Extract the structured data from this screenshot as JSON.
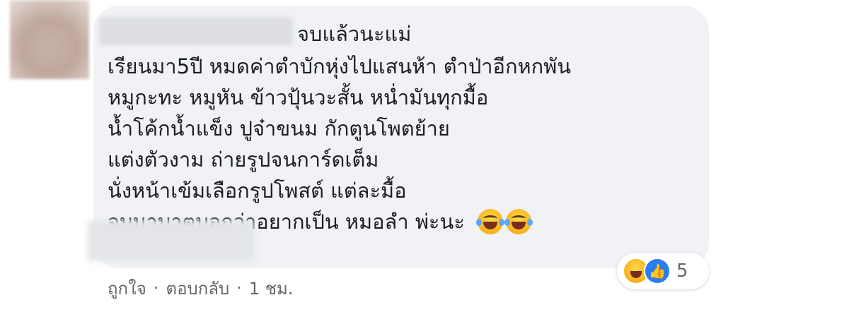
{
  "comment": {
    "first_line": "จบแล้วนะแม่",
    "lines": [
      "เรียนมา5ปี หมดค่าตำบักหุ่งไปแสนห้า ตำป่าอีกหกพัน",
      "หมูกะทะ หมูหัน ข้าวปุ้นวะสั้น หน่ำมันทุกมื้อ",
      "น้ำโค้กน้ำแข็ง ปูจ๋าขนม กักตูนโพตย้าย",
      "แต่งตัวงาม ถ่ายรูปจนการ์ดเต็ม",
      "นั่งหน้าเข้มเลือกรูปโพสต์ แต่ละมื้อ",
      "จบมาบาตบอกว่าอยากเป็น หมอลำ พ่ะนะ"
    ],
    "trailing_emoji": [
      "face-with-tears-of-joy",
      "face-with-tears-of-joy"
    ]
  },
  "reactions": {
    "icons": [
      "haha-reaction-icon",
      "like-reaction-icon"
    ],
    "count": "5"
  },
  "actions": {
    "like_label": "ถูกใจ",
    "separator": "·",
    "reply_label": "ตอบกลับ",
    "time_label": "1 ชม."
  }
}
